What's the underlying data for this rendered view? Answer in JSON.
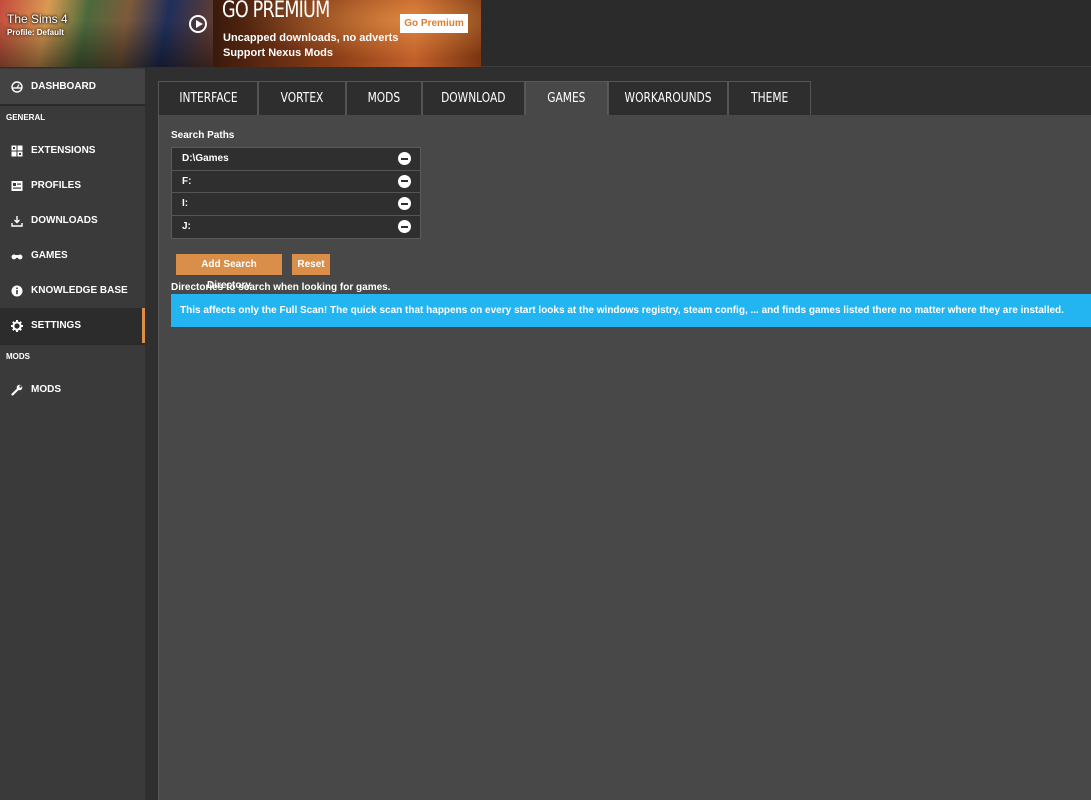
{
  "game": {
    "title": "The Sims 4",
    "profile": "Profile: Default"
  },
  "premium": {
    "heading": "GO PREMIUM",
    "line1": "Uncapped downloads, no adverts",
    "line2": "Support Nexus Mods",
    "button": "Go Premium",
    "accent": "#d97f30"
  },
  "sidebar": {
    "dashboard": "DASHBOARD",
    "section_general": "GENERAL",
    "items": [
      {
        "label": "EXTENSIONS",
        "icon": "grid-icon"
      },
      {
        "label": "PROFILES",
        "icon": "profiles-icon"
      },
      {
        "label": "DOWNLOADS",
        "icon": "download-icon"
      },
      {
        "label": "GAMES",
        "icon": "gamepad-icon"
      },
      {
        "label": "KNOWLEDGE BASE",
        "icon": "info-icon"
      },
      {
        "label": "SETTINGS",
        "icon": "gear-icon",
        "active": true
      }
    ],
    "section_mods": "MODS",
    "mods_item": {
      "label": "MODS",
      "icon": "wrench-icon"
    },
    "active_accent": "#d98f4a"
  },
  "tabs": [
    {
      "label": "INTERFACE"
    },
    {
      "label": "VORTEX"
    },
    {
      "label": "MODS"
    },
    {
      "label": "DOWNLOAD"
    },
    {
      "label": "GAMES",
      "active": true
    },
    {
      "label": "WORKAROUNDS"
    },
    {
      "label": "THEME"
    }
  ],
  "games_settings": {
    "search_paths_label": "Search Paths",
    "paths": [
      "D:\\Games",
      "F:",
      "I:",
      "J:"
    ],
    "add_button": "Add Search Directory",
    "reset_button": "Reset",
    "help_text": "Directories to search when looking for games.",
    "info": "This affects only the Full Scan! The quick scan that happens on every start looks at the windows registry, steam config, ... and finds games listed there no matter where they are installed.",
    "info_color": "#23b5f1"
  }
}
